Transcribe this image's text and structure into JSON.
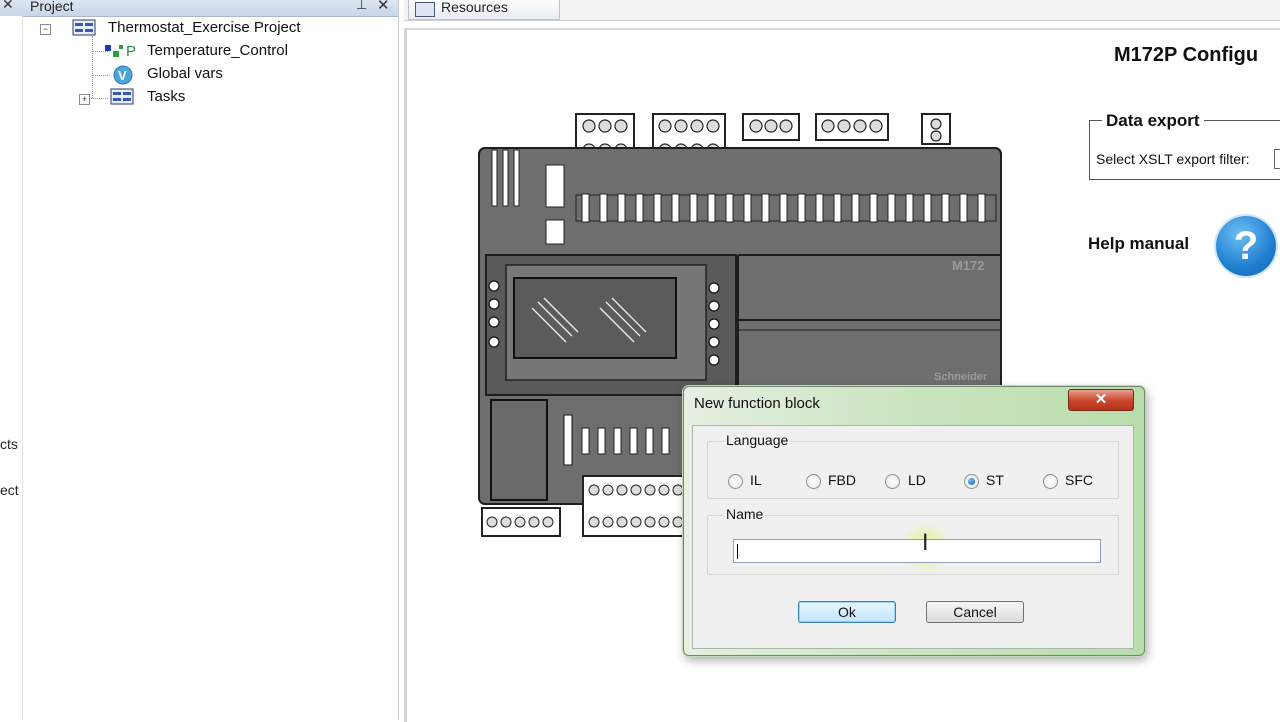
{
  "left_panel": {
    "header_title": "Project",
    "header_glyph_left": "✕",
    "pin_glyph": "🖈",
    "close_glyph": "✕",
    "tree": [
      {
        "label": "Thermostat_Exercise Project",
        "expander": "−"
      },
      {
        "label": "Temperature_Control"
      },
      {
        "label": "Global vars"
      },
      {
        "label": "Tasks",
        "expander": "+"
      }
    ],
    "side_labels": [
      "cts",
      "ect"
    ]
  },
  "resources": {
    "tab_label": "Resources",
    "config_title": "M172P Configu",
    "data_export": {
      "legend": "Data export",
      "filter_label": "Select XSLT export filter:"
    },
    "help_manual_label": "Help manual",
    "help_glyph": "?"
  },
  "device": {
    "model_label": "M172",
    "brand_label": "Schneider"
  },
  "dialog": {
    "title": "New function block",
    "close_glyph": "✕",
    "language_group_label": "Language",
    "languages": [
      {
        "label": "IL",
        "checked": false
      },
      {
        "label": "FBD",
        "checked": false
      },
      {
        "label": "LD",
        "checked": false
      },
      {
        "label": "ST",
        "checked": true
      },
      {
        "label": "SFC",
        "checked": false
      }
    ],
    "name_group_label": "Name",
    "name_value": "",
    "ok_label": "Ok",
    "cancel_label": "Cancel"
  }
}
